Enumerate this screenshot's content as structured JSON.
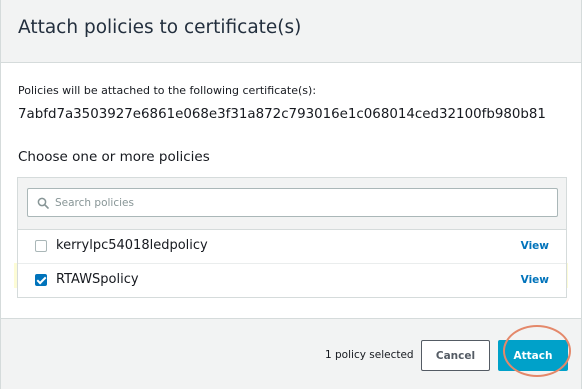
{
  "dialog": {
    "title": "Attach policies to certificate(s)"
  },
  "certificate": {
    "intro": "Policies will be attached to the following certificate(s):",
    "id": "7abfd7a3503927e6861e068e3f31a872c793016e1c068014ced32100fb980b81"
  },
  "policies": {
    "heading": "Choose one or more policies",
    "search_placeholder": "Search policies",
    "items": [
      {
        "name": "kerrylpc54018ledpolicy",
        "checked": false,
        "view_label": "View"
      },
      {
        "name": "RTAWSpolicy",
        "checked": true,
        "view_label": "View"
      }
    ]
  },
  "footer": {
    "selection_count": "1 policy selected",
    "cancel_label": "Cancel",
    "attach_label": "Attach"
  },
  "colors": {
    "primary": "#00a1c9",
    "link": "#0073bb",
    "checkbox_checked": "#0073bb",
    "selected_row_highlight": "#fdfcd6",
    "annotation_circle": "#e4886a"
  },
  "icons": {
    "search": "search-icon",
    "checkmark": "check-icon"
  }
}
